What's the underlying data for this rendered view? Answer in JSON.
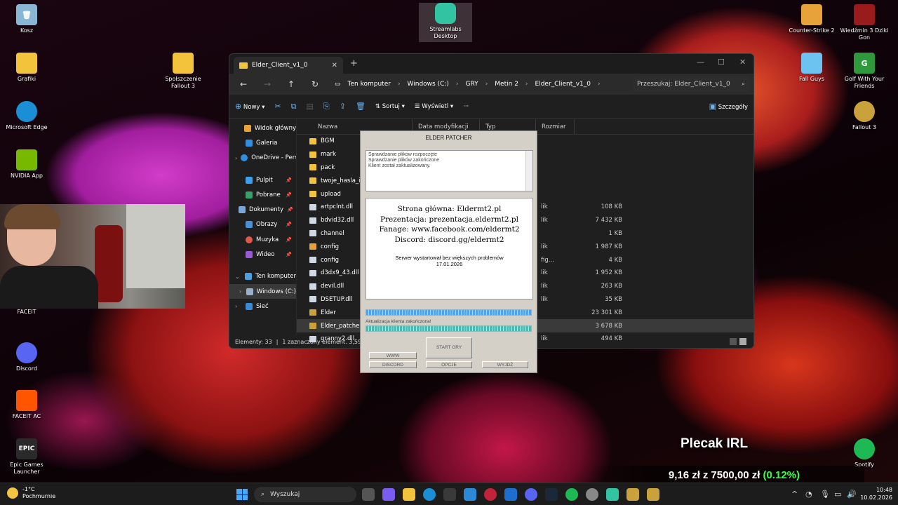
{
  "desktop": {
    "icons_left": [
      {
        "label": "Kosz",
        "icon": "recycle-bin-icon",
        "color": "#8ab6d6"
      },
      {
        "label": "Grafiki",
        "icon": "folder-icon",
        "color": "#f3c43b"
      },
      {
        "label": "Microsoft Edge",
        "icon": "edge-icon",
        "color": "#1b8fd6"
      },
      {
        "label": "NVIDIA App",
        "icon": "nvidia-icon",
        "color": "#76b900"
      },
      {
        "label": "FACEIT",
        "icon": "faceit-icon",
        "color": "#ff5500"
      },
      {
        "label": "Discord",
        "icon": "discord-icon",
        "color": "#5865f2"
      },
      {
        "label": "FACEIT AC",
        "icon": "faceit-ac-icon",
        "color": "#ff5500"
      },
      {
        "label": "Epic Games Launcher",
        "icon": "epic-games-icon",
        "color": "#2a2a2a"
      }
    ],
    "icons_mid": [
      {
        "label": "Spolszczenie Fallout 3",
        "icon": "folder-icon",
        "color": "#f3c43b"
      },
      {
        "label": "Streamlabs Desktop",
        "icon": "streamlabs-icon",
        "color": "#31c3a2"
      }
    ],
    "icons_right": [
      {
        "label": "Counter-Strike 2",
        "icon": "cs2-icon",
        "color": "#e8a23a"
      },
      {
        "label": "Wiedźmin 3 Dziki Gon",
        "icon": "witcher-icon",
        "color": "#9a1b1b"
      },
      {
        "label": "Fall Guys",
        "icon": "fall-guys-icon",
        "color": "#6cc3f0"
      },
      {
        "label": "Golf With Your Friends",
        "icon": "golf-icon",
        "color": "#2f9a3c"
      },
      {
        "label": "Fallout 3",
        "icon": "fallout-icon",
        "color": "#c9a23c"
      },
      {
        "label": "Spotify",
        "icon": "spotify-icon",
        "color": "#1db954"
      }
    ]
  },
  "explorer": {
    "tab_title": "Elder_Client_v1_0",
    "breadcrumbs": [
      "Ten komputer",
      "Windows (C:)",
      "GRY",
      "Metin 2",
      "Elder_Client_v1_0"
    ],
    "search_placeholder": "Przeszukaj: Elder_Client_v1_0",
    "toolbar": {
      "new": "Nowy",
      "sort": "Sortuj",
      "view": "Wyświetl",
      "details": "Szczegóły"
    },
    "nav": [
      {
        "label": "Widok główny",
        "color": "#e8a23a"
      },
      {
        "label": "Galeria",
        "color": "#2f8fe0"
      },
      {
        "label": "OneDrive - Pers",
        "color": "#2f8fe0"
      },
      {
        "label": "Pulpit",
        "color": "#3aa0f0"
      },
      {
        "label": "Pobrane",
        "color": "#3aa06a"
      },
      {
        "label": "Dokumenty",
        "color": "#7aa7d8"
      },
      {
        "label": "Obrazy",
        "color": "#4a8fd8"
      },
      {
        "label": "Muzyka",
        "color": "#e0584a"
      },
      {
        "label": "Wideo",
        "color": "#9a5ad8"
      },
      {
        "label": "Ten komputer",
        "color": "#4aa0e0"
      },
      {
        "label": "Windows (C:)",
        "color": "#9ab0c8"
      },
      {
        "label": "Sieć",
        "color": "#3a8ad8"
      }
    ],
    "columns": {
      "name": "Nazwa",
      "date": "Data modyfikacji",
      "type": "Typ",
      "size": "Rozmiar"
    },
    "files": [
      {
        "name": "BGM",
        "kind": "folder",
        "type": "",
        "size": ""
      },
      {
        "name": "mark",
        "kind": "folder",
        "type": "",
        "size": ""
      },
      {
        "name": "pack",
        "kind": "folder",
        "type": "",
        "size": ""
      },
      {
        "name": "twoje_hasla_i_us",
        "kind": "folder",
        "type": "",
        "size": ""
      },
      {
        "name": "upload",
        "kind": "folder",
        "type": "",
        "size": ""
      },
      {
        "name": "artpclnt.dll",
        "kind": "file",
        "type": "lik",
        "size": "108 KB"
      },
      {
        "name": "bdvid32.dll",
        "kind": "file",
        "type": "lik",
        "size": "7 432 KB"
      },
      {
        "name": "channel",
        "kind": "file",
        "type": "",
        "size": "1 KB"
      },
      {
        "name": "config",
        "kind": "cfg",
        "type": "lik",
        "size": "1 987 KB"
      },
      {
        "name": "config",
        "kind": "file",
        "type": "fig...",
        "size": "4 KB"
      },
      {
        "name": "d3dx9_43.dll",
        "kind": "file",
        "type": "lik",
        "size": "1 952 KB"
      },
      {
        "name": "devil.dll",
        "kind": "file",
        "type": "lik",
        "size": "263 KB"
      },
      {
        "name": "DSETUP.dll",
        "kind": "file",
        "type": "lik",
        "size": "35 KB"
      },
      {
        "name": "Elder",
        "kind": "exe",
        "type": "",
        "size": "23 301 KB"
      },
      {
        "name": "Elder_patcher",
        "kind": "exe",
        "type": "",
        "size": "3 678 KB"
      },
      {
        "name": "granny2.dll",
        "kind": "file",
        "type": "lik",
        "size": "494 KB"
      }
    ],
    "status": {
      "count": "Elementy: 33",
      "selected": "1 zaznaczony element. 3,59 MB"
    }
  },
  "patcher": {
    "title": "ELDER PATCHER",
    "log": [
      "Sprawdzanie plików rozpoczęte",
      "Sprawdzanie plików zakończone",
      "Klient został zaktualizowany."
    ],
    "info": [
      "Strona główna: Eldermt2.pl",
      "Prezentacja: prezentacja.eldermt2.pl",
      "Fanage: www.facebook.com/eldermt2",
      "Discord: discord.gg/eldermt2"
    ],
    "note1": "Serwer wystartował bez większych problemów",
    "note2": "17.01.2026",
    "progress_label": "Aktualizacja klienta zakończona!",
    "progress_top": 1.0,
    "progress_bottom": 1.0,
    "buttons": {
      "www": "WWW",
      "discord": "DISCORD",
      "start": "START GRY",
      "options": "OPCJE",
      "exit": "WYJDŹ"
    }
  },
  "overlay": {
    "title": "Plecak IRL",
    "amount": "9,16 zł",
    "of": "z",
    "goal": "7500,00 zł",
    "percent": "(0.12%)"
  },
  "taskbar": {
    "temp": "-1°C",
    "weather": "Pochmurnie",
    "search": "Wyszukaj",
    "time": "10:48",
    "date": "10.02.2026"
  }
}
